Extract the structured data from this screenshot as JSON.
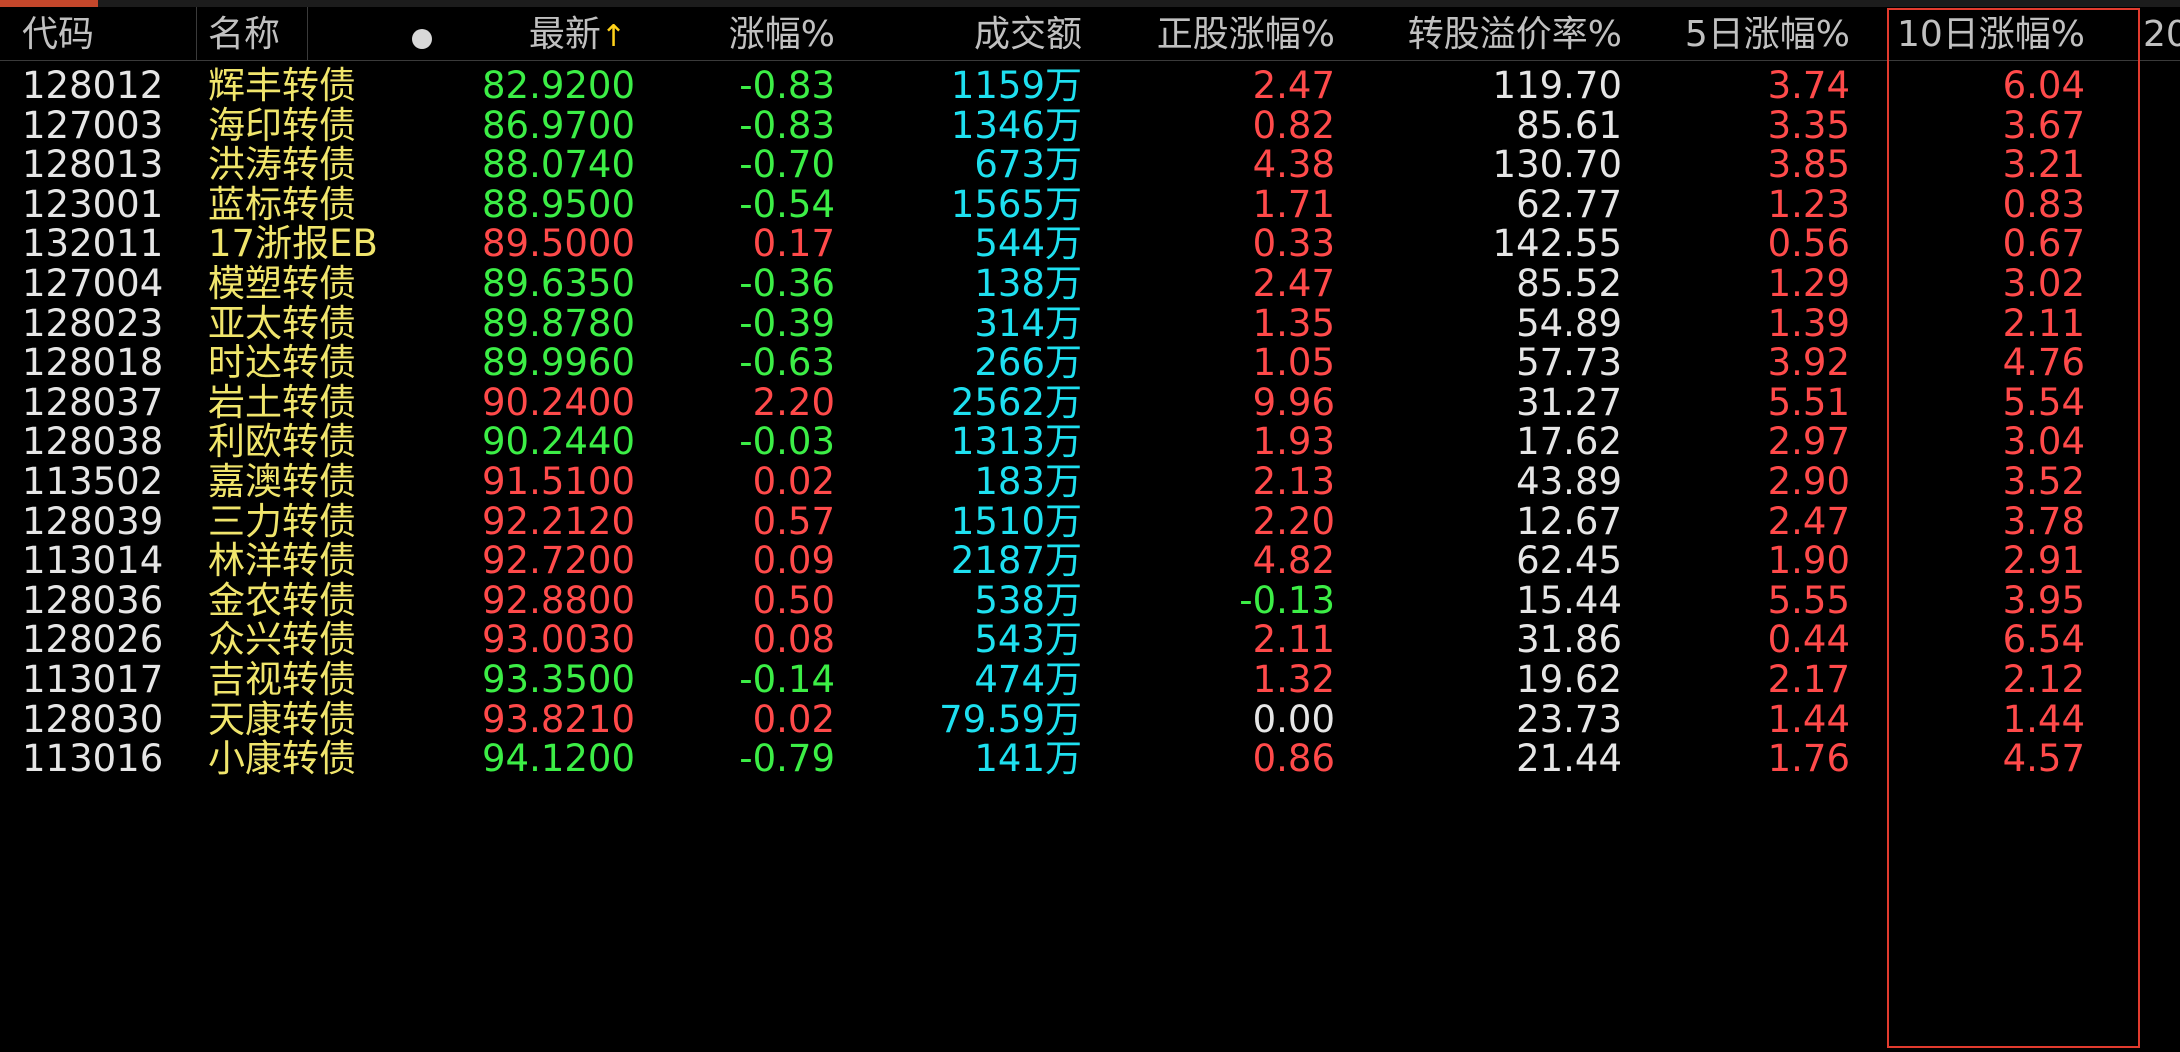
{
  "table": {
    "columns": {
      "code": "代码",
      "name": "名称",
      "last": "最新",
      "change_pct": "涨幅%",
      "turnover": "成交额",
      "stock_change_pct": "正股涨幅%",
      "conversion_premium": "转股溢价率%",
      "change_5d": "5日涨幅%",
      "change_10d": "10日涨幅%",
      "overflow": "20"
    },
    "sort_indicator": "↑",
    "unit": "万",
    "colors": {
      "up": "#ff4a4a",
      "down": "#3cee46",
      "neutral": "#e6e6e6",
      "name": "#f0e56c",
      "turnover": "#1ee0f0",
      "highlight_box": "#e23b2e"
    },
    "rows": [
      {
        "code": "128012",
        "name": "辉丰转债",
        "last": "82.9200",
        "change_pct": "-0.83",
        "turnover": "1159",
        "stock_change_pct": "2.47",
        "conversion_premium": "119.70",
        "change_5d": "3.74",
        "change_10d": "6.04"
      },
      {
        "code": "127003",
        "name": "海印转债",
        "last": "86.9700",
        "change_pct": "-0.83",
        "turnover": "1346",
        "stock_change_pct": "0.82",
        "conversion_premium": "85.61",
        "change_5d": "3.35",
        "change_10d": "3.67"
      },
      {
        "code": "128013",
        "name": "洪涛转债",
        "last": "88.0740",
        "change_pct": "-0.70",
        "turnover": "673",
        "stock_change_pct": "4.38",
        "conversion_premium": "130.70",
        "change_5d": "3.85",
        "change_10d": "3.21"
      },
      {
        "code": "123001",
        "name": "蓝标转债",
        "last": "88.9500",
        "change_pct": "-0.54",
        "turnover": "1565",
        "stock_change_pct": "1.71",
        "conversion_premium": "62.77",
        "change_5d": "1.23",
        "change_10d": "0.83"
      },
      {
        "code": "132011",
        "name": "17浙报EB",
        "last": "89.5000",
        "change_pct": "0.17",
        "turnover": "544",
        "stock_change_pct": "0.33",
        "conversion_premium": "142.55",
        "change_5d": "0.56",
        "change_10d": "0.67"
      },
      {
        "code": "127004",
        "name": "模塑转债",
        "last": "89.6350",
        "change_pct": "-0.36",
        "turnover": "138",
        "stock_change_pct": "2.47",
        "conversion_premium": "85.52",
        "change_5d": "1.29",
        "change_10d": "3.02"
      },
      {
        "code": "128023",
        "name": "亚太转债",
        "last": "89.8780",
        "change_pct": "-0.39",
        "turnover": "314",
        "stock_change_pct": "1.35",
        "conversion_premium": "54.89",
        "change_5d": "1.39",
        "change_10d": "2.11"
      },
      {
        "code": "128018",
        "name": "时达转债",
        "last": "89.9960",
        "change_pct": "-0.63",
        "turnover": "266",
        "stock_change_pct": "1.05",
        "conversion_premium": "57.73",
        "change_5d": "3.92",
        "change_10d": "4.76"
      },
      {
        "code": "128037",
        "name": "岩土转债",
        "last": "90.2400",
        "change_pct": "2.20",
        "turnover": "2562",
        "stock_change_pct": "9.96",
        "conversion_premium": "31.27",
        "change_5d": "5.51",
        "change_10d": "5.54"
      },
      {
        "code": "128038",
        "name": "利欧转债",
        "last": "90.2440",
        "change_pct": "-0.03",
        "turnover": "1313",
        "stock_change_pct": "1.93",
        "conversion_premium": "17.62",
        "change_5d": "2.97",
        "change_10d": "3.04"
      },
      {
        "code": "113502",
        "name": "嘉澳转债",
        "last": "91.5100",
        "change_pct": "0.02",
        "turnover": "183",
        "stock_change_pct": "2.13",
        "conversion_premium": "43.89",
        "change_5d": "2.90",
        "change_10d": "3.52"
      },
      {
        "code": "128039",
        "name": "三力转债",
        "last": "92.2120",
        "change_pct": "0.57",
        "turnover": "1510",
        "stock_change_pct": "2.20",
        "conversion_premium": "12.67",
        "change_5d": "2.47",
        "change_10d": "3.78"
      },
      {
        "code": "113014",
        "name": "林洋转债",
        "last": "92.7200",
        "change_pct": "0.09",
        "turnover": "2187",
        "stock_change_pct": "4.82",
        "conversion_premium": "62.45",
        "change_5d": "1.90",
        "change_10d": "2.91"
      },
      {
        "code": "128036",
        "name": "金农转债",
        "last": "92.8800",
        "change_pct": "0.50",
        "turnover": "538",
        "stock_change_pct": "-0.13",
        "conversion_premium": "15.44",
        "change_5d": "5.55",
        "change_10d": "3.95"
      },
      {
        "code": "128026",
        "name": "众兴转债",
        "last": "93.0030",
        "change_pct": "0.08",
        "turnover": "543",
        "stock_change_pct": "2.11",
        "conversion_premium": "31.86",
        "change_5d": "0.44",
        "change_10d": "6.54"
      },
      {
        "code": "113017",
        "name": "吉视转债",
        "last": "93.3500",
        "change_pct": "-0.14",
        "turnover": "474",
        "stock_change_pct": "1.32",
        "conversion_premium": "19.62",
        "change_5d": "2.17",
        "change_10d": "2.12"
      },
      {
        "code": "128030",
        "name": "天康转债",
        "last": "93.8210",
        "change_pct": "0.02",
        "turnover": "79.59",
        "stock_change_pct": "0.00",
        "conversion_premium": "23.73",
        "change_5d": "1.44",
        "change_10d": "1.44"
      },
      {
        "code": "113016",
        "name": "小康转债",
        "last": "94.1200",
        "change_pct": "-0.79",
        "turnover": "141",
        "stock_change_pct": "0.86",
        "conversion_premium": "21.44",
        "change_5d": "1.76",
        "change_10d": "4.57"
      }
    ]
  }
}
